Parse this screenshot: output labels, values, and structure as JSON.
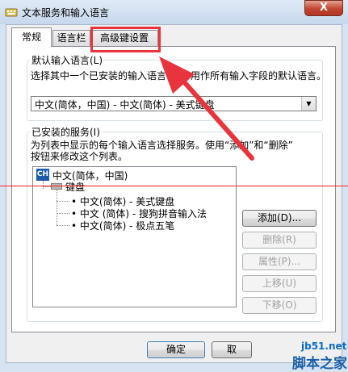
{
  "window": {
    "title": "文本服务和输入语言",
    "close_label": "X"
  },
  "tabs": [
    {
      "label": "常规",
      "active": true
    },
    {
      "label": "语言栏",
      "active": false
    },
    {
      "label": "高级键设置",
      "active": false
    }
  ],
  "default_lang": {
    "group_label": "默认输入语言(L)",
    "desc_part1": "选择其中一个已安装的输入语言",
    "desc_part2": "用作所有输入字段的默认语言。",
    "selected": "中文(简体，中国) - 中文(简体) - 美式键盘"
  },
  "services": {
    "group_label": "已安装的服务(I)",
    "desc_line1": "为列表中显示的每个输入语言选择服务。使用“添加”和“删除”",
    "desc_line2": "按钮来修改这个列表。",
    "tree": {
      "language_icon": "CH",
      "language": "中文(简体，中国)",
      "category": "键盘",
      "items": [
        "中文(简体) - 美式键盘",
        "中文 (简体) - 搜狗拼音输入法",
        "中文(简体) - 极点五笔"
      ]
    },
    "buttons": {
      "add": "添加(D)...",
      "remove": "删除(R)",
      "properties": "属性(P)...",
      "move_up": "上移(U)",
      "move_down": "下移(O)"
    }
  },
  "footer": {
    "ok": "确定",
    "cancel": "取"
  },
  "watermark": {
    "site": "jb51.net",
    "brand": "脚本之家"
  },
  "colors": {
    "annotation_red": "#e8343c",
    "tree_selected_icon": "#1c5aad"
  }
}
